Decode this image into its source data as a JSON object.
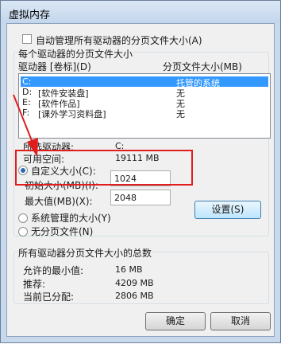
{
  "window": {
    "title": "虚拟内存"
  },
  "auto_manage": {
    "label": "自动管理所有驱动器的分页文件大小(A)",
    "checked": false
  },
  "drive_group": {
    "label": "每个驱动器的分页文件大小",
    "col_drive": "驱动器 [卷标](D)",
    "col_size": "分页文件大小(MB)",
    "rows": [
      {
        "drive": "C:",
        "label": "",
        "size": "托管的系统",
        "selected": true
      },
      {
        "drive": "D:",
        "label": "[软件安装盘]",
        "size": "无",
        "selected": false
      },
      {
        "drive": "E:",
        "label": "[软件作品]",
        "size": "无",
        "selected": false
      },
      {
        "drive": "F:",
        "label": "[课外学习资料盘]",
        "size": "无",
        "selected": false
      }
    ],
    "selected_drive_label": "所选驱动器:",
    "selected_drive_value": "C:",
    "free_space_label": "可用空间:",
    "free_space_value": "19111 MB",
    "custom_size": {
      "label": "自定义大小(C):",
      "selected": true
    },
    "initial_size": {
      "label": "初始大小(MB)(I):",
      "value": "1024"
    },
    "max_size": {
      "label": "最大值(MB)(X):",
      "value": "2048"
    },
    "system_managed": {
      "label": "系统管理的大小(Y)",
      "selected": false
    },
    "no_paging": {
      "label": "无分页文件(N)",
      "selected": false
    },
    "set_button": "设置(S)"
  },
  "total_group": {
    "label": "所有驱动器分页文件大小的总数",
    "min_label": "允许的最小值:",
    "min_value": "16 MB",
    "recommended_label": "推荐:",
    "recommended_value": "4209 MB",
    "current_label": "当前已分配:",
    "current_value": "2806 MB"
  },
  "buttons": {
    "ok": "确定",
    "cancel": "取消"
  },
  "colors": {
    "annotation_red": "#e01e1e",
    "selection_blue": "#3399ff"
  }
}
